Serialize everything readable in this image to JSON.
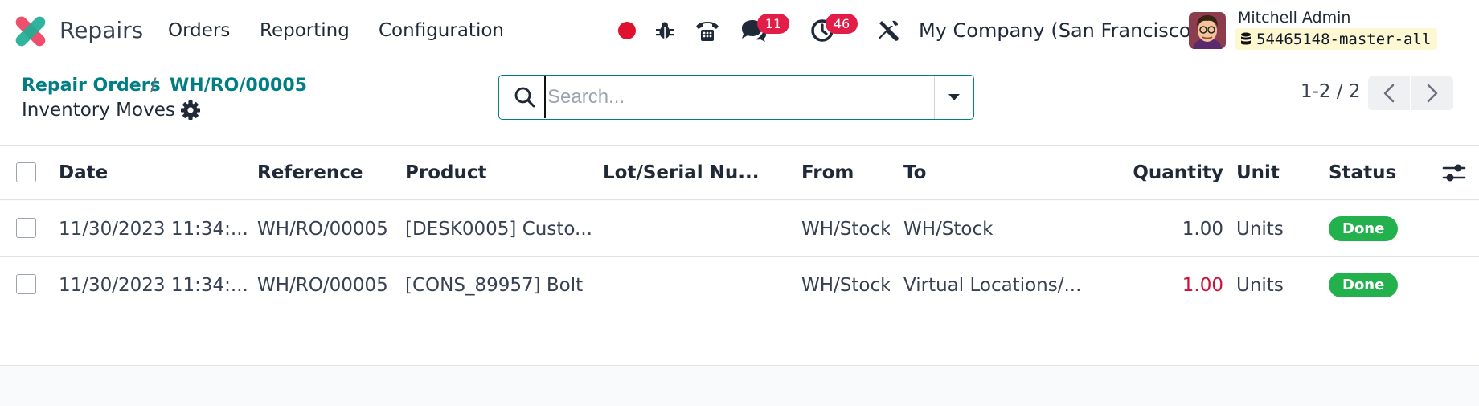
{
  "navbar": {
    "app_name": "Repairs",
    "menus": [
      "Orders",
      "Reporting",
      "Configuration"
    ],
    "icons": [
      "record-icon",
      "bug-icon",
      "phone-icon",
      "chat-icon",
      "clock-icon",
      "tools-icon"
    ],
    "chat_count": "11",
    "activity_count": "46",
    "company": "My Company (San Francisco)",
    "user_name": "Mitchell Admin",
    "database": "54465148-master-all"
  },
  "breadcrumb": {
    "parent": "Repair Orders",
    "separator": "/",
    "current": "WH/RO/00005",
    "sub_title": "Inventory Moves"
  },
  "search": {
    "placeholder": "Search...",
    "value": ""
  },
  "pager": {
    "value": "1-2 / 2"
  },
  "table": {
    "columns": [
      "Date",
      "Reference",
      "Product",
      "Lot/Serial Nu...",
      "From",
      "To",
      "Quantity",
      "Unit",
      "Status"
    ],
    "rows": [
      {
        "date": "11/30/2023 11:34:...",
        "reference": "WH/RO/00005",
        "product": "[DESK0005] Custo...",
        "lot": "",
        "from": "WH/Stock",
        "to": "WH/Stock",
        "quantity": "1.00",
        "unit": "Units",
        "status": "Done"
      },
      {
        "date": "11/30/2023 11:34:...",
        "reference": "WH/RO/00005",
        "product": "[CONS_89957] Bolt",
        "lot": "",
        "from": "WH/Stock",
        "to": "Virtual Locations/...",
        "quantity": "1.00",
        "unit": "Units",
        "status": "Done"
      }
    ]
  },
  "colors": {
    "primary": "#017e84",
    "badge_red": "#e11d48",
    "status_done": "#22b14c",
    "negative_qty": "#d0103a",
    "record_red": "#e0102f"
  }
}
